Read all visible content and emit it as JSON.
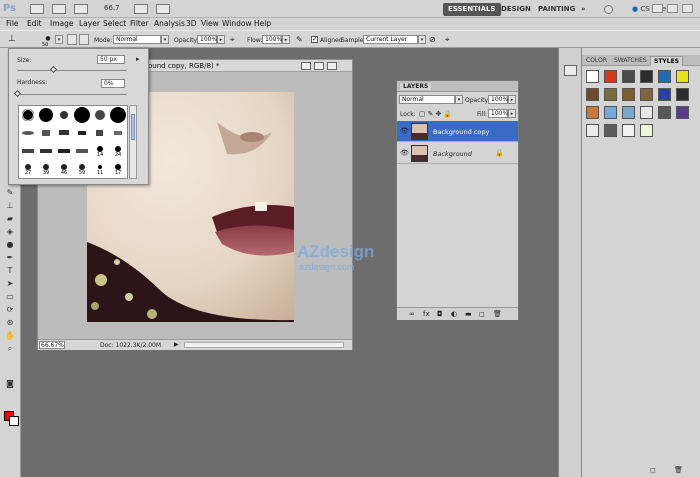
{
  "app": {
    "logo": "Ps",
    "zoom": "66.7"
  },
  "workspace": {
    "essentials": "ESSENTIALS",
    "design": "DESIGN",
    "painting": "PAINTING",
    "more": "»",
    "cslive": "CS Live"
  },
  "menu": [
    "File",
    "Edit",
    "Image",
    "Layer",
    "Select",
    "Filter",
    "Analysis",
    "3D",
    "View",
    "Window",
    "Help"
  ],
  "options": {
    "brush_size": "50",
    "mode_label": "Mode:",
    "mode_value": "Normal",
    "opacity_label": "Opacity:",
    "opacity_value": "100%",
    "flow_label": "Flow:",
    "flow_value": "100%",
    "aligned_label": "Aligned",
    "sample_label": "Sample:",
    "sample_value": "Current Layer"
  },
  "brush_popup": {
    "size_label": "Size:",
    "size_value": "50 px",
    "hardness_label": "Hardness:",
    "hardness_value": "0%",
    "size_slider_fraction": 0.33,
    "hardness_slider_fraction": 0.0,
    "labels": [
      "14",
      "24",
      "27",
      "39",
      "46",
      "59",
      "11",
      "17"
    ]
  },
  "document": {
    "title": "ound copy, RGB/8) *",
    "zoom": "66.67%",
    "doc_info": "Doc: 1022.3K/2.00M"
  },
  "watermark": {
    "line1": "AZdesign",
    "line2": "azdesign.com"
  },
  "layers": {
    "tab": "LAYERS",
    "blend": "Normal",
    "opacity_label": "Opacity:",
    "opacity_value": "100%",
    "lock_label": "Lock:",
    "fill_label": "Fill:",
    "fill_value": "100%",
    "items": [
      {
        "name": "Background copy",
        "selected": true
      },
      {
        "name": "Background",
        "selected": false
      }
    ]
  },
  "right_panel": {
    "tabs": [
      "COLOR",
      "SWATCHES",
      "STYLES"
    ],
    "active_tab": "STYLES",
    "styles": [
      "#ffffff",
      "#d23a1b",
      "#4a4a4a",
      "#2d2d2d",
      "#1f6bb8",
      "#e8e020",
      "#6b4d2a",
      "#7a6a40",
      "#7a5e2e",
      "#7d6540",
      "#2c3ea8",
      "#2c2c2c",
      "#c87838",
      "#7aa8d8",
      "#7aa6c8",
      "#e8e8e8",
      "#585858",
      "#5a3c88",
      "#ececec",
      "#5c5c5c",
      "#f2f2f2",
      "#eef6d8"
    ]
  },
  "colors": {
    "foreground": "#ff0000",
    "background": "#ffffff",
    "selection": "#3a6cc7"
  }
}
